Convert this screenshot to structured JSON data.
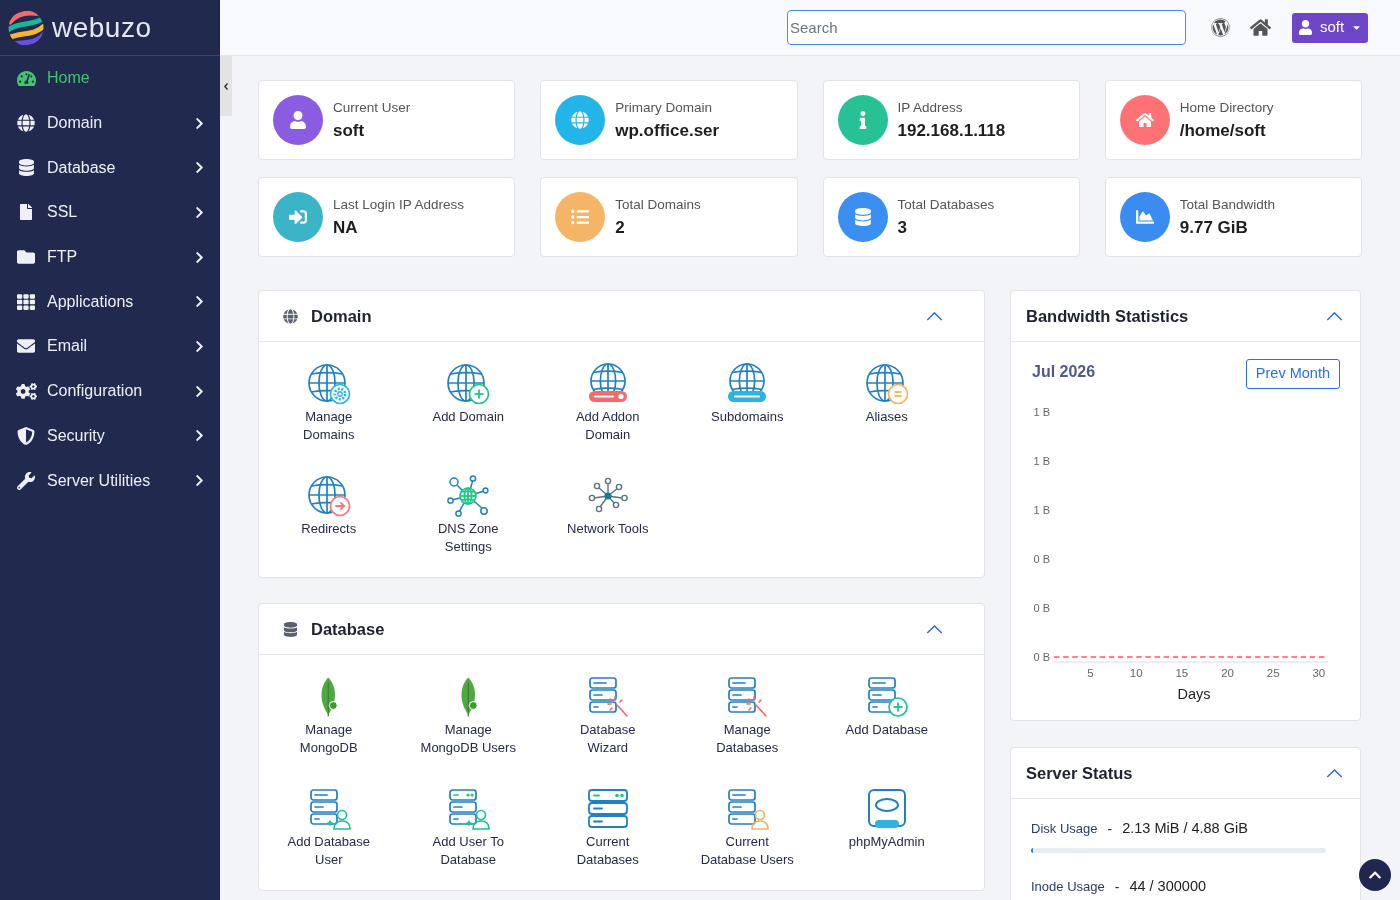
{
  "sidebar": {
    "logo": "webuzo",
    "items": [
      {
        "label": "Home",
        "kind": "link",
        "selected": true
      },
      {
        "label": "Domain",
        "kind": "menu",
        "selected": false
      },
      {
        "label": "Database",
        "kind": "menu",
        "selected": false
      },
      {
        "label": "SSL",
        "kind": "menu",
        "selected": false
      },
      {
        "label": "FTP",
        "kind": "menu",
        "selected": false
      },
      {
        "label": "Applications",
        "kind": "menu",
        "selected": false
      },
      {
        "label": "Email",
        "kind": "menu",
        "selected": false
      },
      {
        "label": "Configuration",
        "kind": "menu",
        "selected": false
      },
      {
        "label": "Security",
        "kind": "menu",
        "selected": false
      },
      {
        "label": "Server Utilities",
        "kind": "menu",
        "selected": false
      }
    ]
  },
  "topbar": {
    "search": {
      "placeholder": "Search"
    },
    "user_menu": "soft"
  },
  "stats": [
    {
      "label": "Current User",
      "value": "soft",
      "color": "#8c5ce0"
    },
    {
      "label": "Primary Domain",
      "value": "wp.office.ser",
      "color": "#23b5e8"
    },
    {
      "label": "IP Address",
      "value": "192.168.1.118",
      "color": "#26c195"
    },
    {
      "label": "Home Directory",
      "value": "/home/soft",
      "color": "#fe7276"
    },
    {
      "label": "Last Login IP Address",
      "value": "NA",
      "color": "#3cb4c8"
    },
    {
      "label": "Total Domains",
      "value": "2",
      "color": "#f5b566"
    },
    {
      "label": "Total Databases",
      "value": "3",
      "color": "#3a8ff0"
    },
    {
      "label": "Total Bandwidth",
      "value": "9.77 GiB",
      "color": "#3b8cf0"
    }
  ],
  "panels": [
    {
      "title": "Domain",
      "expanded": true,
      "tools": [
        "Manage Domains",
        "Add Domain",
        "Add Addon Domain",
        "Subdomains",
        "Aliases",
        "Redirects",
        "DNS Zone Settings",
        "Network Tools"
      ]
    },
    {
      "title": "Database",
      "expanded": true,
      "tools": [
        "Manage MongoDB",
        "Manage MongoDB Users",
        "Database Wizard",
        "Manage Databases",
        "Add Database",
        "Add Database User",
        "Add User To Database",
        "Current Databases",
        "Current Database Users",
        "phpMyAdmin"
      ]
    }
  ],
  "bandwidth": {
    "title": "Bandwidth Statistics",
    "expanded": true,
    "month": "Jul 2026",
    "button": "Prev Month",
    "chart_data": {
      "type": "line",
      "xlabel": "Days",
      "x": [
        1,
        2,
        3,
        4,
        5,
        6,
        7,
        8,
        9,
        10,
        11,
        12,
        13,
        14,
        15,
        16,
        17,
        18,
        19,
        20,
        21,
        22,
        23,
        24,
        25,
        26,
        27,
        28,
        29,
        30,
        31
      ],
      "series": [
        {
          "color": "#ff5b5b",
          "line_style": "dashed",
          "values": [
            0,
            0,
            0,
            0,
            0,
            0,
            0,
            0,
            0,
            0,
            0,
            0,
            0,
            0,
            0,
            0,
            0,
            0,
            0,
            0,
            0,
            0,
            0,
            0,
            0,
            0,
            0,
            0,
            0,
            0,
            0
          ]
        }
      ],
      "xlim": [
        1,
        31
      ],
      "ylim": [
        0,
        1
      ],
      "xticks": [
        5,
        10,
        15,
        20,
        25,
        30
      ],
      "yticks": [
        {
          "value": 1,
          "label": "1 B"
        },
        {
          "value": 0.8,
          "label": "1 B"
        },
        {
          "value": 0.6,
          "label": "1 B"
        },
        {
          "value": 0.4,
          "label": "0 B"
        },
        {
          "value": 0.2,
          "label": "0 B"
        },
        {
          "value": 0,
          "label": "0 B"
        }
      ]
    }
  },
  "server_status": {
    "title": "Server Status",
    "expanded": true,
    "metrics": [
      {
        "label": "Disk Usage",
        "separator": "-",
        "value": "2.13 MiB / 4.88 GiB",
        "level": 0.007
      },
      {
        "label": "Inode Usage",
        "separator": "-",
        "value": "44 / 300000"
      }
    ]
  }
}
